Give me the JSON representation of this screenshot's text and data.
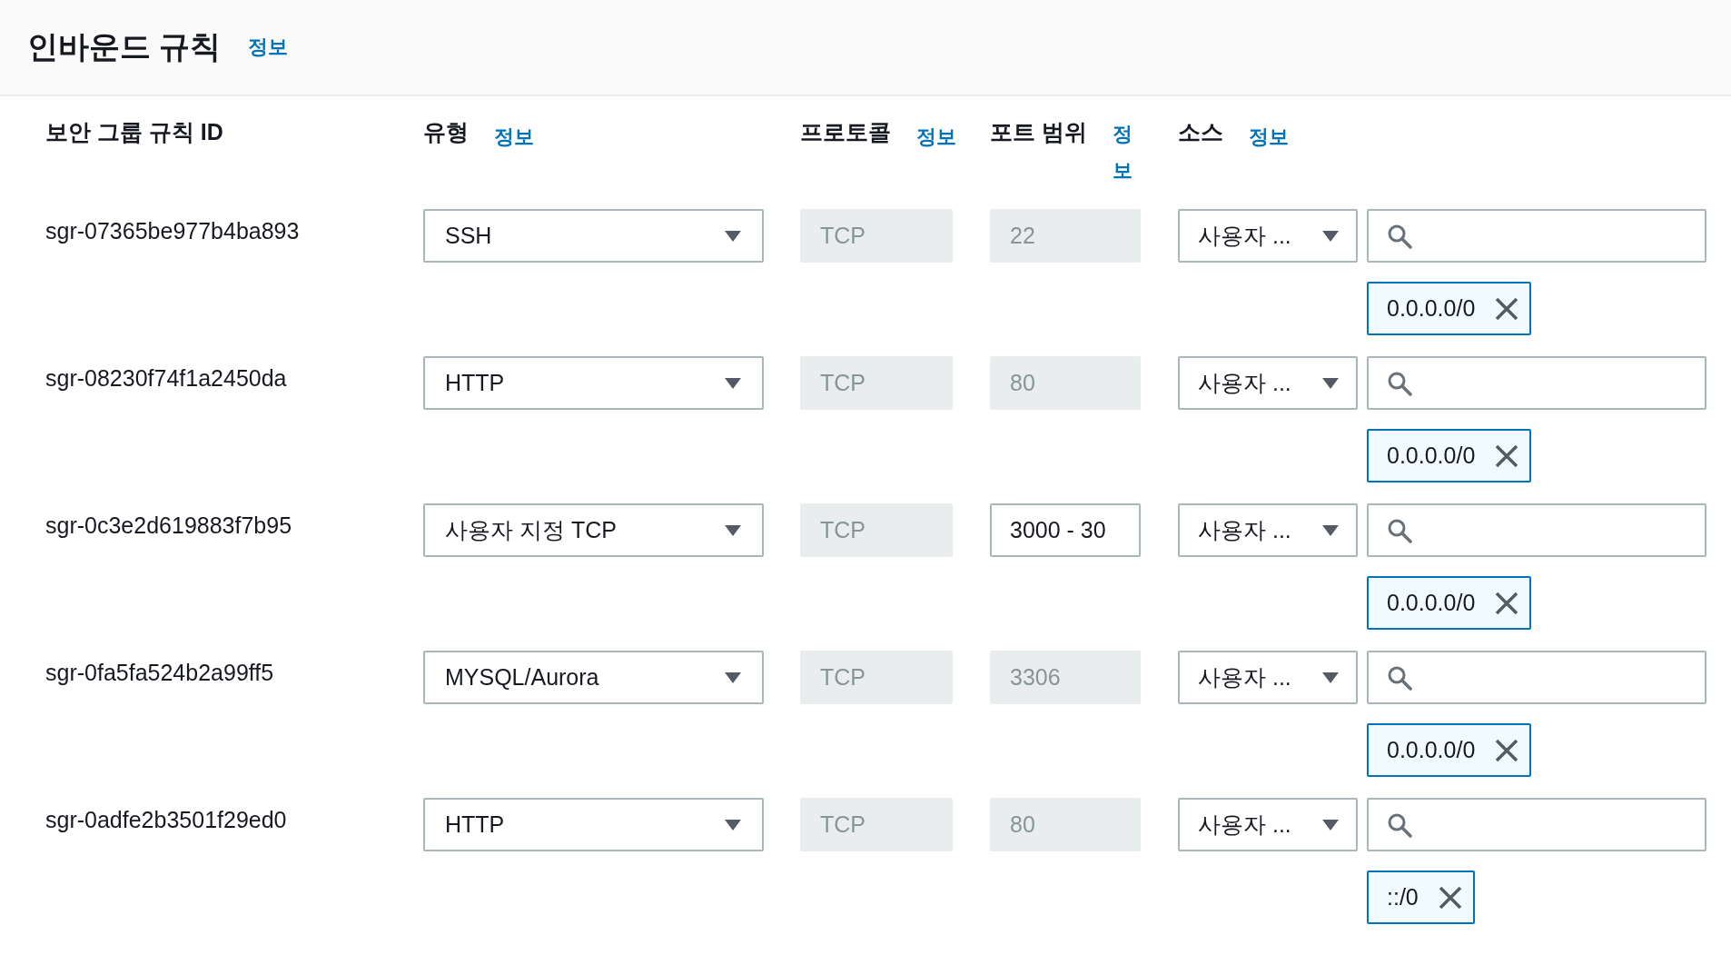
{
  "header": {
    "title": "인바운드 규칙",
    "info_link": "정보"
  },
  "columns": [
    {
      "label": "보안 그룹 규칙 ID"
    },
    {
      "label": "유형",
      "info_link": "정보"
    },
    {
      "label": "프로토콜",
      "info_link": "정보"
    },
    {
      "label": "포트 범위",
      "info_link": "정보"
    },
    {
      "label": "소스",
      "info_link": "정보"
    }
  ],
  "rules": [
    {
      "id": "sgr-07365be977b4ba893",
      "type": "SSH",
      "protocol": {
        "value": "TCP",
        "disabled": true
      },
      "port": {
        "value": "22",
        "disabled": true
      },
      "source_type": "사용자 ...",
      "source_tokens": [
        "0.0.0.0/0"
      ]
    },
    {
      "id": "sgr-08230f74f1a2450da",
      "type": "HTTP",
      "protocol": {
        "value": "TCP",
        "disabled": true
      },
      "port": {
        "value": "80",
        "disabled": true
      },
      "source_type": "사용자 ...",
      "source_tokens": [
        "0.0.0.0/0"
      ]
    },
    {
      "id": "sgr-0c3e2d619883f7b95",
      "type": "사용자 지정 TCP",
      "protocol": {
        "value": "TCP",
        "disabled": true
      },
      "port": {
        "value": "3000 - 30",
        "disabled": false
      },
      "source_type": "사용자 ...",
      "source_tokens": [
        "0.0.0.0/0"
      ]
    },
    {
      "id": "sgr-0fa5fa524b2a99ff5",
      "type": "MYSQL/Aurora",
      "protocol": {
        "value": "TCP",
        "disabled": true
      },
      "port": {
        "value": "3306",
        "disabled": true
      },
      "source_type": "사용자 ...",
      "source_tokens": [
        "0.0.0.0/0"
      ]
    },
    {
      "id": "sgr-0adfe2b3501f29ed0",
      "type": "HTTP",
      "protocol": {
        "value": "TCP",
        "disabled": true
      },
      "port": {
        "value": "80",
        "disabled": true
      },
      "source_type": "사용자 ...",
      "source_tokens": [
        "::/0"
      ]
    }
  ]
}
